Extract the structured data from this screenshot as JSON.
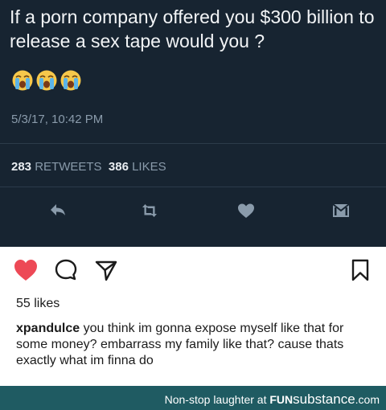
{
  "tweet": {
    "text": "If a porn company offered you $300 billion to release a sex tape would you ?",
    "emoji": [
      "loudly-crying-face",
      "loudly-crying-face",
      "loudly-crying-face"
    ],
    "timestamp": "5/3/17, 10:42 PM",
    "retweets_count": "283",
    "retweets_label": "RETWEETS",
    "likes_count": "386",
    "likes_label": "LIKES",
    "actions": [
      "reply-icon",
      "retweet-icon",
      "heart-icon",
      "direct-message-icon"
    ],
    "colors": {
      "background": "#172431",
      "muted": "#8a9bab",
      "icon": "#8a9bab"
    }
  },
  "instagram": {
    "actions": [
      "heart-filled-icon",
      "comment-icon",
      "share-icon",
      "bookmark-icon"
    ],
    "likes": "55 likes",
    "caption_user": "xpandulce",
    "caption_text": " you think im gonna expose myself like that for some money? embarrass my family like that? cause thats exactly what im finna do",
    "colors": {
      "heart": "#ed4956",
      "text": "#1b1b1b"
    }
  },
  "footer": {
    "text": "Non-stop laughter at",
    "brand_fun": "FUN",
    "brand_substance": "substance",
    "brand_domain": ".com",
    "colors": {
      "background": "#1f5b62"
    }
  }
}
